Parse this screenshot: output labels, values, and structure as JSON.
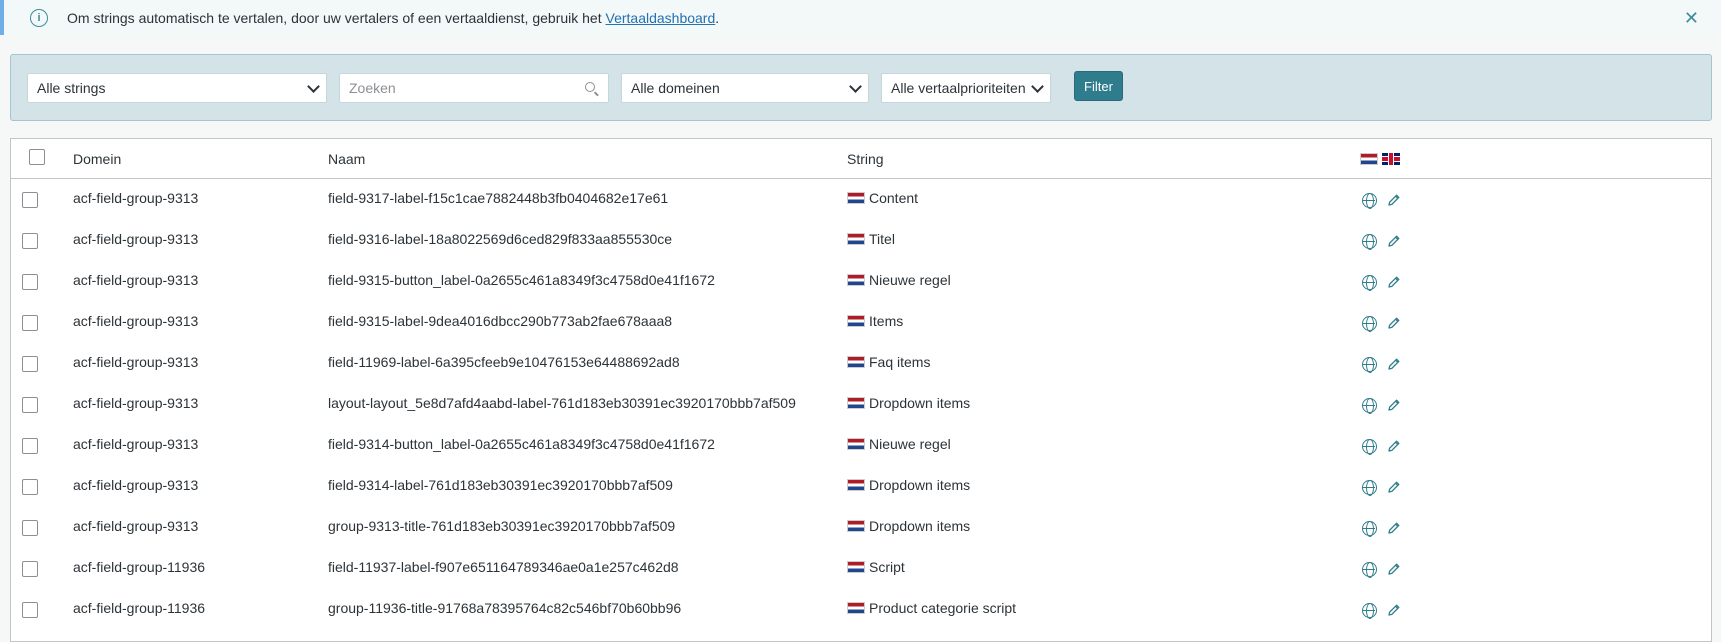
{
  "notice": {
    "text": "Om strings automatisch te vertalen, door uw vertalers of een vertaaldienst, gebruik het ",
    "link": "Vertaaldashboard",
    "suffix": ".",
    "close": "✕"
  },
  "filters": {
    "strings_select": "Alle strings",
    "search_placeholder": "Zoeken",
    "domains_select": "Alle domeinen",
    "priority_select": "Alle vertaalprioriteiten",
    "filter_button": "Filter"
  },
  "table": {
    "headers": {
      "domain": "Domein",
      "name": "Naam",
      "string": "String"
    },
    "rows": [
      {
        "domain": "acf-field-group-9313",
        "name": "field-9317-label-f15c1cae7882448b3fb0404682e17e61",
        "string": "Content"
      },
      {
        "domain": "acf-field-group-9313",
        "name": "field-9316-label-18a8022569d6ced829f833aa855530ce",
        "string": "Titel"
      },
      {
        "domain": "acf-field-group-9313",
        "name": "field-9315-button_label-0a2655c461a8349f3c4758d0e41f1672",
        "string": "Nieuwe regel"
      },
      {
        "domain": "acf-field-group-9313",
        "name": "field-9315-label-9dea4016dbcc290b773ab2fae678aaa8",
        "string": "Items"
      },
      {
        "domain": "acf-field-group-9313",
        "name": "field-11969-label-6a395cfeeb9e10476153e64488692ad8",
        "string": "Faq items"
      },
      {
        "domain": "acf-field-group-9313",
        "name": "layout-layout_5e8d7afd4aabd-label-761d183eb30391ec3920170bbb7af509",
        "string": "Dropdown items"
      },
      {
        "domain": "acf-field-group-9313",
        "name": "field-9314-button_label-0a2655c461a8349f3c4758d0e41f1672",
        "string": "Nieuwe regel"
      },
      {
        "domain": "acf-field-group-9313",
        "name": "field-9314-label-761d183eb30391ec3920170bbb7af509",
        "string": "Dropdown items"
      },
      {
        "domain": "acf-field-group-9313",
        "name": "group-9313-title-761d183eb30391ec3920170bbb7af509",
        "string": "Dropdown items"
      },
      {
        "domain": "acf-field-group-11936",
        "name": "field-11937-label-f907e651164789346ae0a1e257c462d8",
        "string": "Script"
      },
      {
        "domain": "acf-field-group-11936",
        "name": "group-11936-title-91768a78395764c82c546bf70b60bb96",
        "string": "Product categorie script"
      }
    ]
  },
  "icons": {
    "info": "info-icon",
    "close": "close-icon",
    "search": "search-icon",
    "globe": "globe-icon",
    "edit": "pencil-icon",
    "flag_nl": "flag-nl-icon",
    "flag_gb": "flag-gb-icon"
  },
  "colors": {
    "accent": "#2f7d8c",
    "filter_bg": "#d4e3e7",
    "link": "#2271b1"
  }
}
